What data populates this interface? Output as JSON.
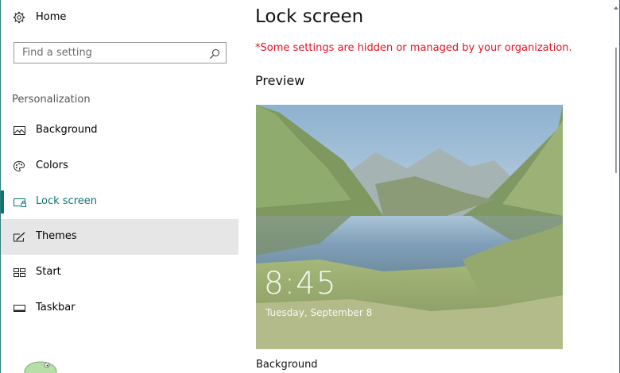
{
  "sidebar": {
    "home_label": "Home",
    "search_placeholder": "Find a setting",
    "section_title": "Personalization",
    "items": [
      {
        "label": "Background",
        "icon": "picture-icon"
      },
      {
        "label": "Colors",
        "icon": "palette-icon"
      },
      {
        "label": "Lock screen",
        "icon": "lock-screen-icon",
        "active": true
      },
      {
        "label": "Themes",
        "icon": "themes-icon",
        "hovered": true
      },
      {
        "label": "Start",
        "icon": "start-icon"
      },
      {
        "label": "Taskbar",
        "icon": "taskbar-icon"
      }
    ]
  },
  "main": {
    "title": "Lock screen",
    "managed_notice": "*Some settings are hidden or managed by your organization.",
    "preview_label": "Preview",
    "preview": {
      "time": "8:45",
      "date": "Tuesday, September 8"
    },
    "background_label": "Background"
  },
  "colors": {
    "accent": "#0d7373",
    "warning": "#e81123",
    "hover": "#e6e6e6"
  }
}
